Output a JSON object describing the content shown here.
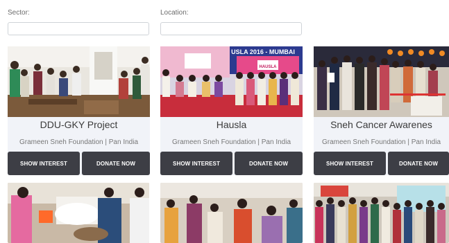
{
  "filters": {
    "sector_label": "Sector:",
    "sector_value": "",
    "location_label": "Location:",
    "location_value": ""
  },
  "cards": [
    {
      "title": "DDU-GKY Project",
      "subtitle": "Grameen Sneh Foundation | Pan India",
      "show_interest_label": "SHOW INTEREST",
      "donate_label": "DONATE NOW"
    },
    {
      "title": "Hausla",
      "subtitle": "Grameen Sneh Foundation | Pan India",
      "show_interest_label": "SHOW INTEREST",
      "donate_label": "DONATE NOW",
      "banner_text": "USLA 2016 - MUMBAI",
      "banner_brand": "HAUSLA"
    },
    {
      "title": "Sneh Cancer Awarenes",
      "subtitle": "Grameen Sneh Foundation | Pan India",
      "show_interest_label": "SHOW INTEREST",
      "donate_label": "DONATE NOW"
    }
  ],
  "colors": {
    "button_bg": "#3d3e45",
    "card_bg": "#f1f3f8",
    "input_border": "#cfd3d8"
  }
}
